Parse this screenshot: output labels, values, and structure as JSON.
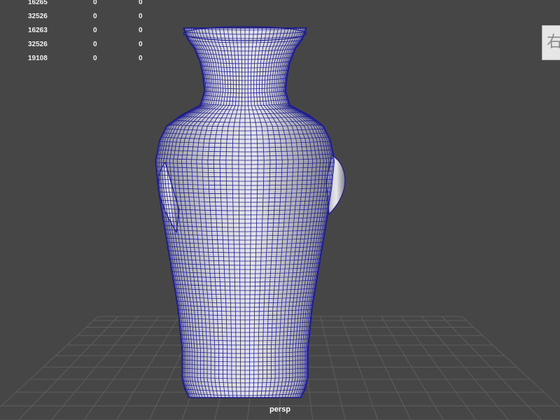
{
  "viewport": {
    "camera_label": "persp",
    "object_icon": "vase-mesh",
    "wireframe_color": "#1c1c8f",
    "background_color": "#464646"
  },
  "hud": {
    "rows": [
      {
        "c0": "16265",
        "c1": "0",
        "c2": "0"
      },
      {
        "c0": "32526",
        "c1": "0",
        "c2": "0"
      },
      {
        "c0": "16263",
        "c1": "0",
        "c2": "0"
      },
      {
        "c0": "32526",
        "c1": "0",
        "c2": "0"
      },
      {
        "c0": "19108",
        "c1": "0",
        "c2": "0"
      }
    ]
  },
  "side_tab": {
    "text": "右",
    "icon": "panel-tab-icon"
  }
}
